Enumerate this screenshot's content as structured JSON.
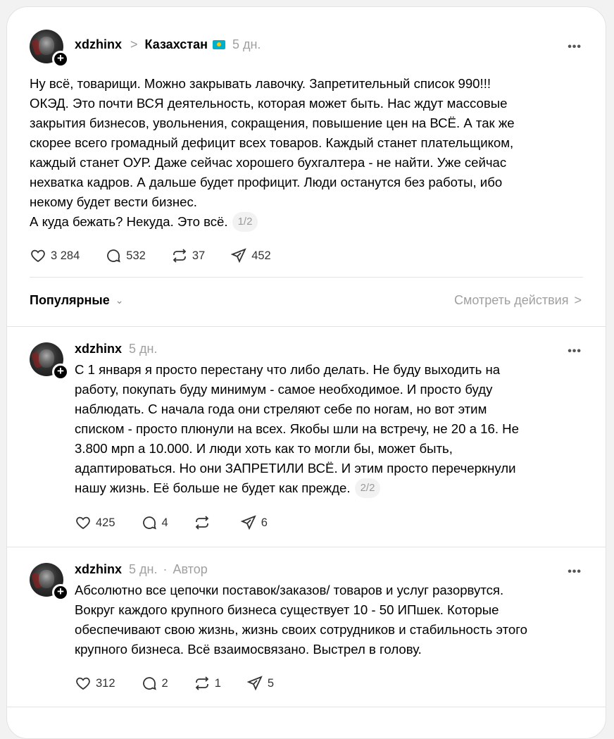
{
  "main_post": {
    "username": "xdzhinx",
    "topic": "Казахстан",
    "time": "5 дн.",
    "text": "Ну всё, товарищи. Можно закрывать лавочку. Запретительный список 990!!!\nОКЭД. Это почти ВСЯ деятельность, которая может быть. Нас ждут массовые\nзакрытия бизнесов, увольнения, сокращения, повышение цен на ВСЁ. А так же\nскорее всего громадный дефицит всех товаров. Каждый станет плательщиком,\nкаждый станет ОУР. Даже сейчас хорошего бухгалтера - не найти. Уже сейчас\nнехватка кадров. А дальше будет профицит. Люди останутся без работы, ибо\nнекому будет вести бизнес.\nА куда бежать? Некуда. Это всё.",
    "pager": "1/2",
    "likes": "3 284",
    "replies": "532",
    "reposts": "37",
    "shares": "452"
  },
  "filter": {
    "label": "Популярные",
    "view_activity": "Смотреть действия"
  },
  "replies": [
    {
      "username": "xdzhinx",
      "time": "5 дн.",
      "author": "",
      "text": "С 1 января я просто перестану что либо делать. Не буду выходить на\nработу, покупать буду минимум - самое необходимое. И просто буду\nнаблюдать. С начала года они стреляют себе по ногам, но вот этим\nсписком - просто плюнули на всех. Якобы шли на встречу, не 20 а 16. Не\n3.800 мрп а 10.000. И люди хоть как то могли бы, может быть,\nадаптироваться. Но они ЗАПРЕТИЛИ ВСЁ. И этим просто перечеркнули\nнашу жизнь. Её больше не будет как прежде.",
      "pager": "2/2",
      "likes": "425",
      "replies": "4",
      "reposts": "",
      "shares": "6"
    },
    {
      "username": "xdzhinx",
      "time": "5 дн.",
      "author": "Автор",
      "text": "Абсолютно все цепочки поставок/заказов/ товаров и услуг разорвутся.\nВокруг каждого крупного бизнеса существует 10 - 50 ИПшек. Которые\nобеспечивают свою жизнь, жизнь своих сотрудников и стабильность этого\nкрупного бизнеса. Всё взаимосвязано. Выстрел в голову.",
      "pager": "",
      "likes": "312",
      "replies": "2",
      "reposts": "1",
      "shares": "5"
    }
  ],
  "icons": {
    "more": "•••",
    "plus": "+",
    "chevron": ">",
    "caret_down": "⌄"
  }
}
